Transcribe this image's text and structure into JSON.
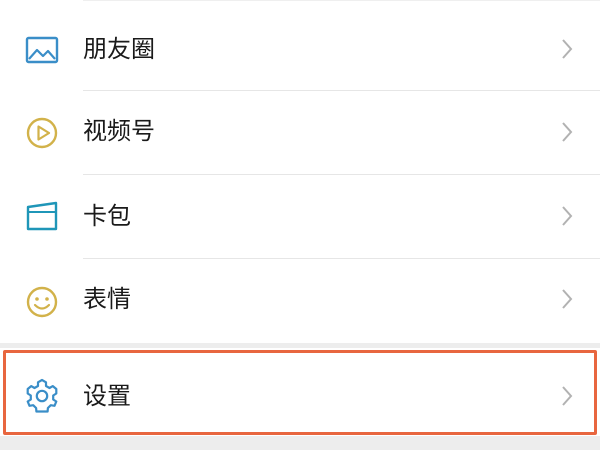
{
  "menu": {
    "items": [
      {
        "label": "朋友圈",
        "icon": "moments-icon"
      },
      {
        "label": "视频号",
        "icon": "channels-icon"
      },
      {
        "label": "卡包",
        "icon": "card-wallet-icon"
      },
      {
        "label": "表情",
        "icon": "sticker-icon"
      }
    ],
    "settings": {
      "label": "设置",
      "icon": "gear-icon"
    }
  },
  "colors": {
    "icon_blue": "#3a8ec8",
    "icon_teal": "#1f96b8",
    "icon_gold": "#d2b24a",
    "label_text": "#1a1a1a",
    "chevron": "#b2b2b2",
    "highlight_border": "#e8663f",
    "background": "#ededed"
  }
}
